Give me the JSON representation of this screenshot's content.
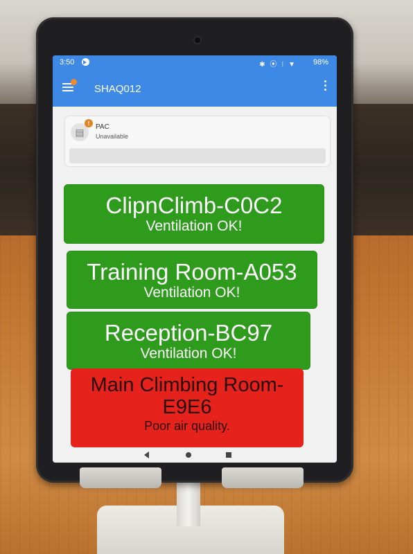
{
  "status_bar": {
    "time": "3:50",
    "icons": "✱ ⦿ ⁝ ▼",
    "battery": "98%"
  },
  "app_bar": {
    "title": "SHAQ012"
  },
  "pac": {
    "name": "PAC",
    "status": "Unavailable",
    "warning_symbol": "!"
  },
  "rooms": [
    {
      "name": "ClipnClimb-C0C2",
      "status": "Ventilation OK!",
      "color": "#2e9b1d"
    },
    {
      "name": "Training Room-A053",
      "status": "Ventilation OK!",
      "color": "#2e9b1d"
    },
    {
      "name": "Reception-BC97",
      "status": "Ventilation OK!",
      "color": "#2e9b1d"
    },
    {
      "name": "Main Climbing Room-E9E6",
      "status": "Poor air quality.",
      "color": "#e5221b"
    }
  ]
}
